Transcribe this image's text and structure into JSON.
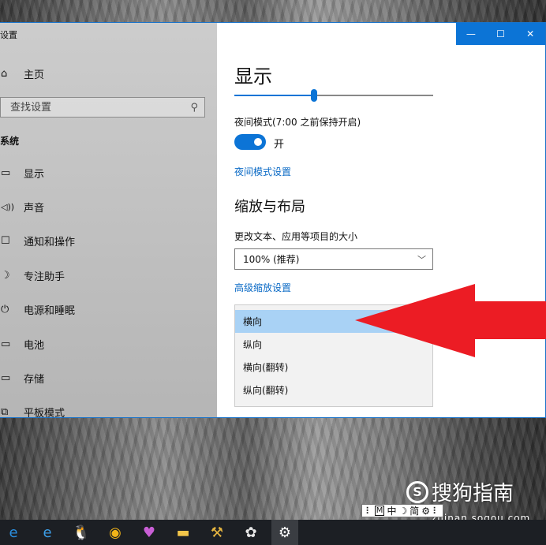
{
  "window": {
    "title": "设置",
    "controls": {
      "minimize": "—",
      "maximize": "☐",
      "close": "✕"
    }
  },
  "sidebar": {
    "home": {
      "icon": "home-icon",
      "label": "主页"
    },
    "search": {
      "placeholder": "查找设置",
      "icon": "search-icon"
    },
    "section": "系统",
    "items": [
      {
        "icon": "monitor-icon",
        "label": "显示"
      },
      {
        "icon": "speaker-icon",
        "label": "声音"
      },
      {
        "icon": "message-icon",
        "label": "通知和操作"
      },
      {
        "icon": "moon-icon",
        "label": "专注助手"
      },
      {
        "icon": "power-icon",
        "label": "电源和睡眠"
      },
      {
        "icon": "battery-icon",
        "label": "电池"
      },
      {
        "icon": "storage-icon",
        "label": "存储"
      },
      {
        "icon": "tablet-icon",
        "label": "平板模式"
      }
    ]
  },
  "main": {
    "title": "显示",
    "brightness": 0.4,
    "night_light": {
      "label": "夜间模式(7:00 之前保持开启)",
      "state_label": "开",
      "on": true,
      "settings_link": "夜间模式设置"
    },
    "scale_layout": {
      "heading": "缩放与布局",
      "size_label": "更改文本、应用等项目的大小",
      "size_value": "100% (推荐)",
      "advanced_link": "高级缩放设置"
    },
    "orientation_dropdown": {
      "options": [
        "横向",
        "纵向",
        "横向(翻转)",
        "纵向(翻转)"
      ],
      "selected_index": 0
    }
  },
  "ime": {
    "mode": "M",
    "lang": "中",
    "moon": "☽",
    "simplified": "简",
    "gear": "⚙",
    "more": "⠇"
  },
  "watermark": {
    "brand": "搜狗指南",
    "url": "zhinan.sogou.com"
  },
  "taskbar": {
    "apps": [
      {
        "icon": "ie-icon",
        "glyph": "e",
        "color": "#2b8fe0"
      },
      {
        "icon": "edge-icon",
        "glyph": "e",
        "color": "#3c9ee8"
      },
      {
        "icon": "qq-icon",
        "glyph": "🐧",
        "color": "#fff"
      },
      {
        "icon": "chrome-icon",
        "glyph": "◉",
        "color": "#f2b418"
      },
      {
        "icon": "balloon-icon",
        "glyph": "♥",
        "color": "#c95fd6"
      },
      {
        "icon": "folder-icon",
        "glyph": "▬",
        "color": "#f3c64a"
      },
      {
        "icon": "broom-icon",
        "glyph": "⚒",
        "color": "#e7b640"
      },
      {
        "icon": "paint-icon",
        "glyph": "✿",
        "color": "#e8e8e8"
      },
      {
        "icon": "settings-icon",
        "glyph": "⚙",
        "color": "#ffffff"
      }
    ],
    "active_index": 8
  },
  "colors": {
    "accent": "#0c74d6",
    "arrow": "#ec1c24",
    "selected": "#a9d2f5"
  }
}
